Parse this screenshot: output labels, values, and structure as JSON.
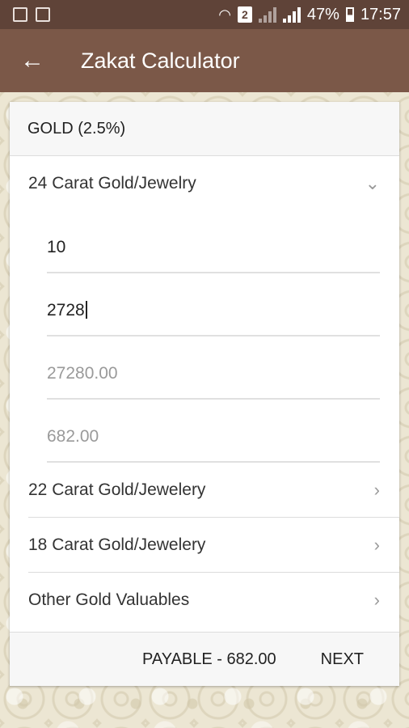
{
  "status_bar": {
    "battery": "47%",
    "time": "17:57",
    "sim_slot": "2"
  },
  "app_bar": {
    "title": "Zakat Calculator",
    "back_icon": "arrow-left-icon"
  },
  "card": {
    "header": "GOLD (2.5%)",
    "sections": [
      {
        "label": "24 Carat Gold/Jewelry",
        "expanded": true
      },
      {
        "label": "22 Carat Gold/Jewelery",
        "expanded": false
      },
      {
        "label": "18 Carat Gold/Jewelery",
        "expanded": false
      },
      {
        "label": "Other Gold Valuables",
        "expanded": false
      }
    ],
    "fields_24k": {
      "weight": "10",
      "rate": "2728",
      "total": "27280.00",
      "zakat": "682.00"
    },
    "footer": {
      "payable": "PAYABLE - 682.00",
      "next": "NEXT"
    }
  }
}
